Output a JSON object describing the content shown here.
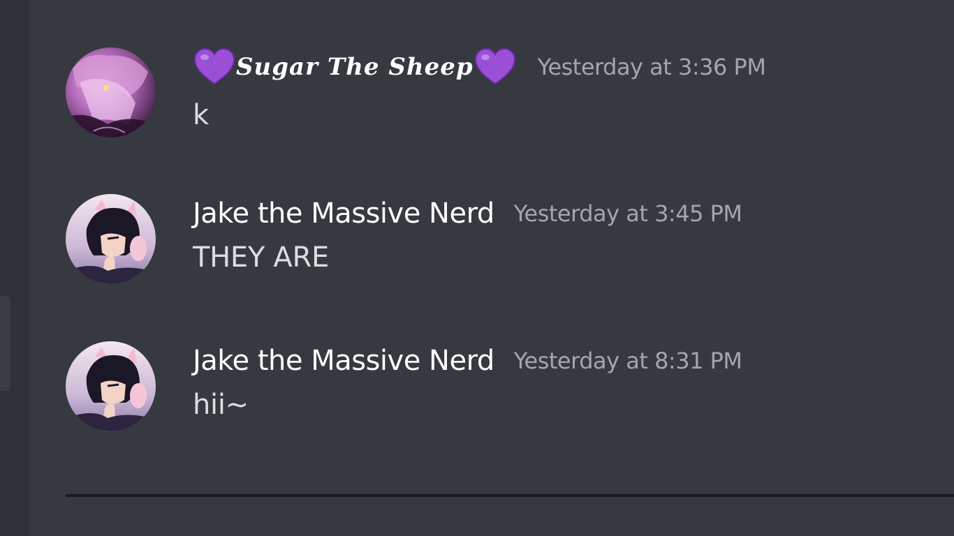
{
  "messages": [
    {
      "username": "Sugar The Sheep",
      "timestamp": "Yesterday at 3:36 PM",
      "content": "k",
      "avatar_icon": "anime-pink-hair-avatar",
      "decoration_icon": "purple-heart-icon",
      "decoration_color": "#9b4fd6"
    },
    {
      "username": "Jake the Massive Nerd",
      "timestamp": "Yesterday at 3:45 PM",
      "content": "THEY ARE",
      "avatar_icon": "anime-cat-ears-avatar"
    },
    {
      "username": "Jake the Massive Nerd",
      "timestamp": "Yesterday at 8:31 PM",
      "content": "hii~",
      "avatar_icon": "anime-cat-ears-avatar"
    }
  ],
  "colors": {
    "background": "#36393f",
    "username": "#ffffff",
    "timestamp": "#a3a6aa",
    "message_text": "#dcddde"
  }
}
